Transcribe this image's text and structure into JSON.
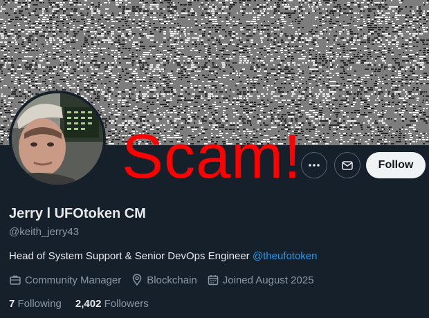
{
  "profile": {
    "display_name": "Jerry l UFOtoken CM",
    "handle": "@keith_jerry43",
    "bio_text": "Head of System Support & Senior DevOps Engineer ",
    "bio_mention": "@theufotoken",
    "category": "Community Manager",
    "location": "Blockchain",
    "joined": "Joined August 2025",
    "following_count": "7",
    "following_label": "Following",
    "followers_count": "2,402",
    "followers_label": "Followers"
  },
  "actions": {
    "more_icon": "more-dots-icon",
    "message_icon": "envelope-icon",
    "follow_label": "Follow"
  },
  "overlay": {
    "text": "Scam!",
    "color": "#ff0000"
  },
  "colors": {
    "background": "#15202b",
    "link": "#1d9bf0",
    "muted": "#8b98a5",
    "follow_button": "#eff3f4"
  }
}
